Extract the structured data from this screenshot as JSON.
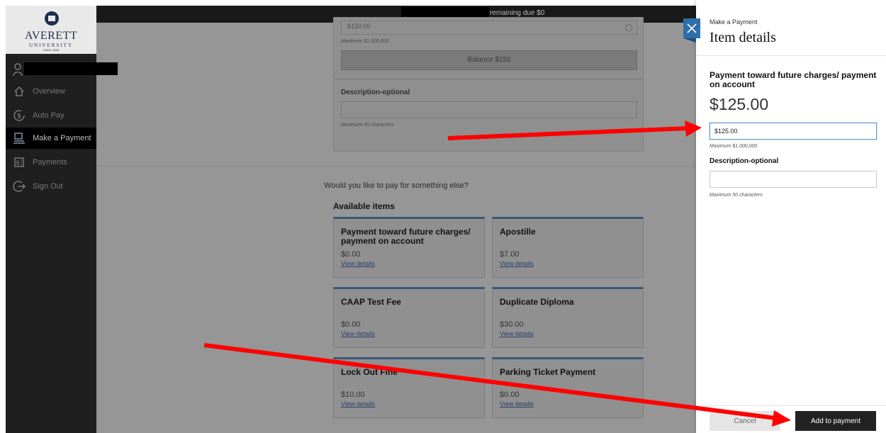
{
  "logo": {
    "name": "AVERETT",
    "sub": "UNIVERSITY",
    "since": "SINCE 1859"
  },
  "sidebar": {
    "items": [
      {
        "label": "Overview",
        "icon": "home-icon"
      },
      {
        "label": "Auto Pay",
        "icon": "auto-pay-icon"
      },
      {
        "label": "Make a Payment",
        "icon": "payment-icon",
        "active": true
      },
      {
        "label": "Payments",
        "icon": "receipt-icon"
      },
      {
        "label": "Sign Out",
        "icon": "sign-out-icon"
      }
    ]
  },
  "main": {
    "top_bar_text": "remaining due $0",
    "upper_card": {
      "amount_value": "$150.00",
      "max_amount": "Maximum $1,000,000",
      "balance_button": "Balance $150",
      "description_label": "Description-optional",
      "max_chars": "Maximum 50 characters"
    },
    "prompt": "Would you like to pay for something else?",
    "available_title": "Available items",
    "view_details": "View details",
    "items": [
      {
        "name": "Payment toward future charges/ payment on account",
        "price": "$0.00"
      },
      {
        "name": "Apostille",
        "price": "$7.00"
      },
      {
        "name": "CAAP Test Fee",
        "price": "$0.00"
      },
      {
        "name": "Duplicate Diploma",
        "price": "$30.00"
      },
      {
        "name": "Lock Out Fine",
        "price": "$10.00"
      },
      {
        "name": "Parking Ticket Payment",
        "price": "$0.00"
      }
    ]
  },
  "panel": {
    "eyebrow": "Make a Payment",
    "title": "Item details",
    "item_name": "Payment toward future charges/ payment on account",
    "item_amount": "$125.00",
    "amount_input_value": "$125.00",
    "max_amount": "Maximum $1,000,000",
    "description_label": "Description-optional",
    "max_chars": "Maximum 50 characters",
    "cancel_label": "Cancel",
    "add_label": "Add to payment"
  },
  "colors": {
    "accent_blue": "#2d6fa8",
    "annotation_red": "#ff0000",
    "sidebar_bg": "#1f1f1f",
    "primary_button": "#222222"
  }
}
